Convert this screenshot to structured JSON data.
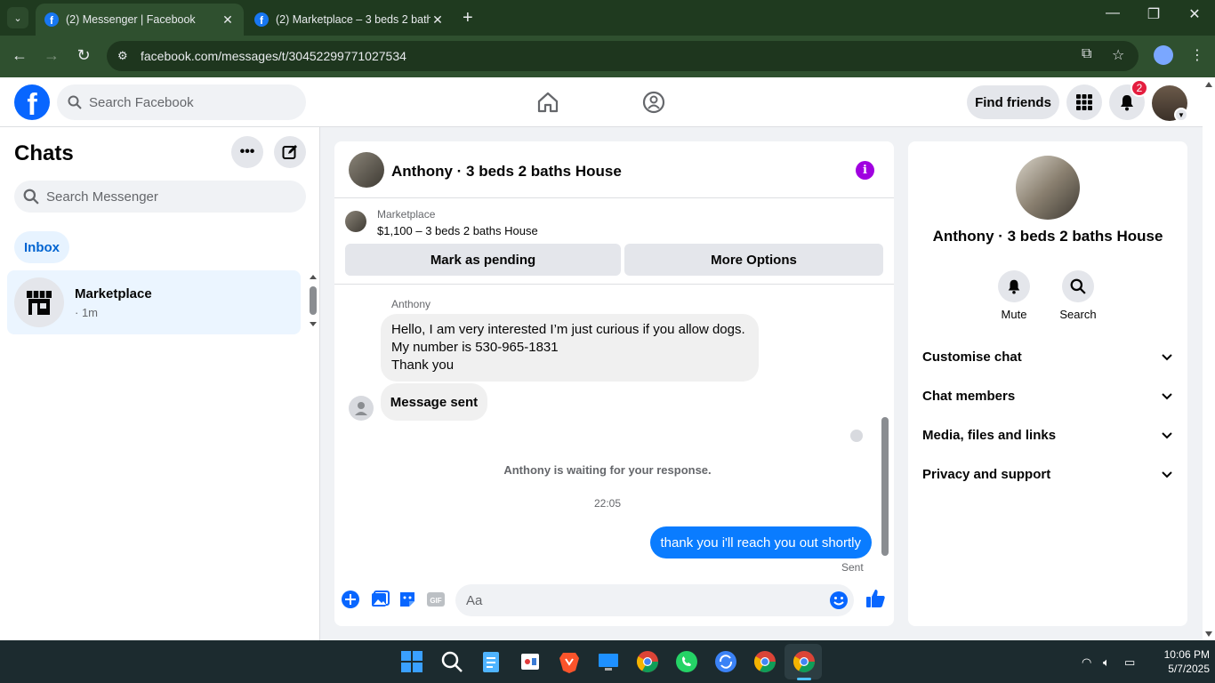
{
  "browser": {
    "tabs": [
      {
        "title": "(2) Messenger | Facebook",
        "active": true
      },
      {
        "title": "(2) Marketplace – 3 beds 2 bath",
        "active": false
      }
    ],
    "url": "facebook.com/messages/t/30452299771027534"
  },
  "fb": {
    "search_placeholder": "Search Facebook",
    "find_friends": "Find friends",
    "notification_count": "2"
  },
  "sidebar": {
    "title": "Chats",
    "search_placeholder": "Search Messenger",
    "filter": "Inbox",
    "chats": [
      {
        "name": "Marketplace",
        "time": "· 1m"
      }
    ]
  },
  "conversation": {
    "title": "Anthony · 3 beds 2 baths House",
    "marketplace_label": "Marketplace",
    "listing": "$1,100 – 3 beds 2 baths House",
    "mark_pending": "Mark as pending",
    "more_options": "More Options",
    "sender": "Anthony",
    "incoming_lines": [
      "Hello, I am very interested I’m just curious if you allow dogs.",
      "My number is 530-965-1831",
      "Thank you"
    ],
    "message_sent": "Message sent",
    "waiting": "Anthony is waiting for your response.",
    "timestamp": "22:05",
    "outgoing": "thank you i'll reach you out shortly",
    "sent_status": "Sent",
    "composer_placeholder": "Aa"
  },
  "info": {
    "name": "Anthony · 3 beds 2 baths House",
    "actions": [
      "Mute",
      "Search"
    ],
    "sections": [
      "Customise chat",
      "Chat members",
      "Media, files and links",
      "Privacy and support"
    ]
  },
  "taskbar": {
    "time": "10:06 PM",
    "date": "5/7/2025"
  },
  "colors": {
    "fb_blue": "#0866ff",
    "bubble_out": "#0a7cff",
    "info_purple": "#a000e0",
    "chrome_green": "#2f502f"
  }
}
